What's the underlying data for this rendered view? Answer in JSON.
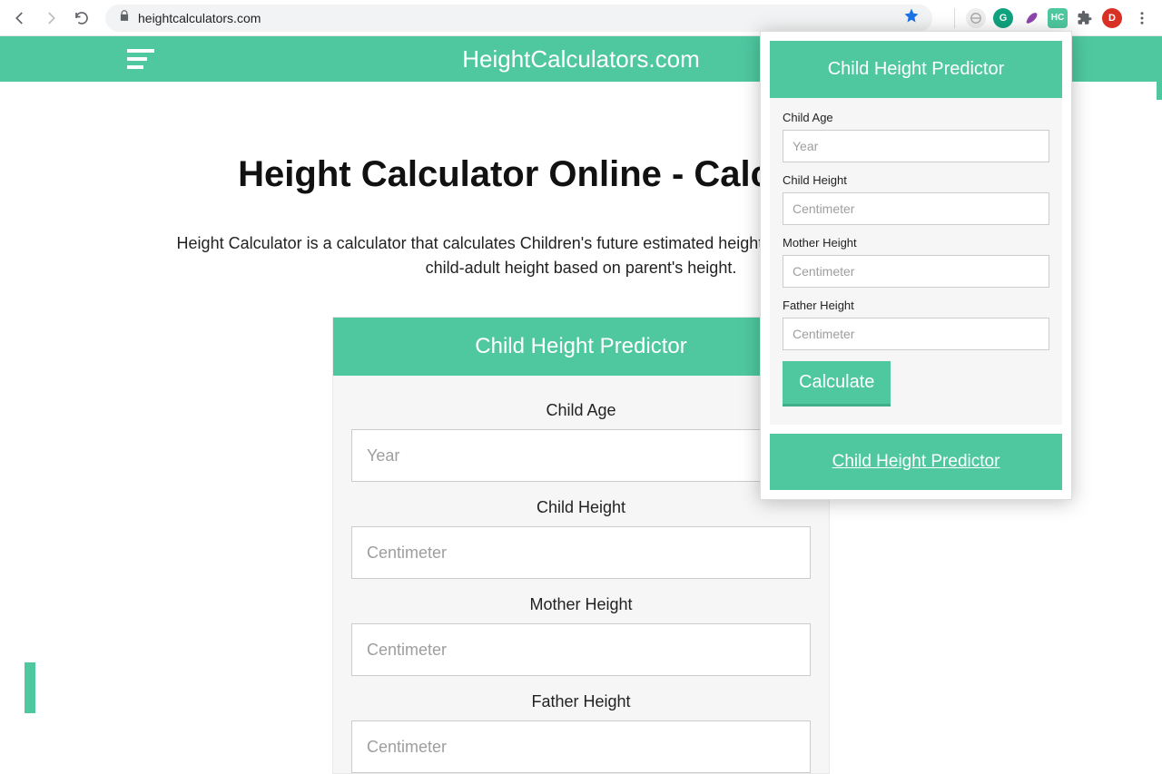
{
  "chrome": {
    "url": "heightcalculators.com",
    "profile_initial": "D",
    "ext_labels": {
      "grammarly": "G",
      "hc": "HC"
    }
  },
  "header": {
    "site_title": "HeightCalculators.com"
  },
  "page": {
    "heading": "Height Calculator Online - Calculate Chi",
    "description": "Height Calculator is a calculator that calculates Children's future estimated height. its also called child calculates child-adult height based on parent's height."
  },
  "main_predictor": {
    "title": "Child Height Predictor",
    "fields": {
      "child_age": {
        "label": "Child Age",
        "placeholder": "Year"
      },
      "child_height": {
        "label": "Child Height",
        "placeholder": "Centimeter"
      },
      "mother_height": {
        "label": "Mother Height",
        "placeholder": "Centimeter"
      },
      "father_height": {
        "label": "Father Height",
        "placeholder": "Centimeter"
      }
    }
  },
  "popup": {
    "title": "Child Height Predictor",
    "fields": {
      "child_age": {
        "label": "Child Age",
        "placeholder": "Year"
      },
      "child_height": {
        "label": "Child Height",
        "placeholder": "Centimeter"
      },
      "mother_height": {
        "label": "Mother Height",
        "placeholder": "Centimeter"
      },
      "father_height": {
        "label": "Father Height",
        "placeholder": "Centimeter"
      }
    },
    "calculate_label": "Calculate",
    "footer_link": "Child Height Predictor"
  },
  "colors": {
    "accent": "#4fc8a0"
  }
}
